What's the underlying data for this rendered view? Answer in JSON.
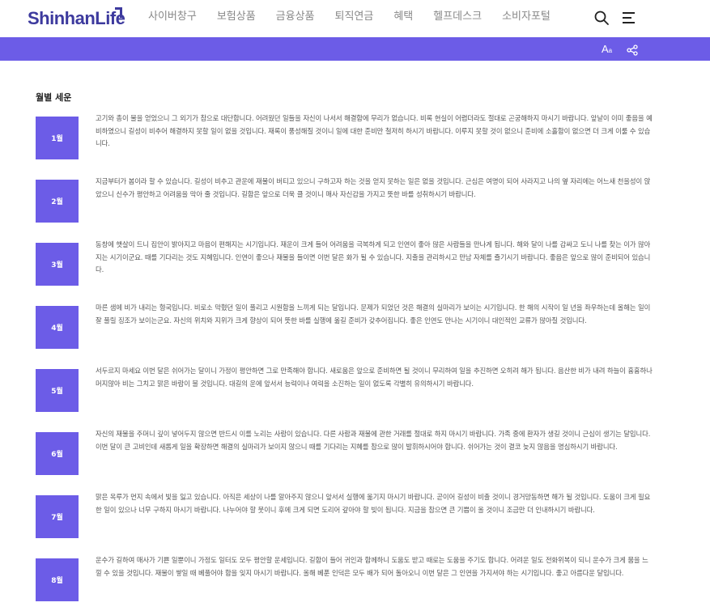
{
  "header": {
    "logo": "ShinhanLife",
    "nav": [
      "사이버창구",
      "보험상품",
      "금융상품",
      "퇴직연금",
      "혜택",
      "헬프데스크",
      "소비자포털"
    ],
    "icons": {
      "search": "search-icon",
      "menu": "menu-icon"
    }
  },
  "toolbar": {
    "font_size_label": "A",
    "font_size_sub": "a",
    "share_icon": "share-icon"
  },
  "colors": {
    "brand": "#3d3a9e",
    "accent": "#6c5ce7"
  },
  "section_title": "월별 세운",
  "months": [
    {
      "label": "1월",
      "text": "고기와 총이 물을 얻었으니 그 외기가 참으로 대단합니다. 어려웠던 일들을 자신이 나서서 해결함에 무리가 없습니다. 비록 현실이 어렵더라도 절대로 곤궁해하지 마시기 바랍니다. 앞날이 이미 좋음을 예비하였으니 길성이 비추어 해결하지 못할 일이 없을 것입니다. 재록이 풍성해질 것이니 일에 대한 준비만 철저히 하시기 바랍니다. 이루지 못할 것이 없으니 준비에 소홀함이 없으면 더 크게 이룰 수 있습니다."
    },
    {
      "label": "2월",
      "text": "지금부터가 봄이라 할 수 있습니다. 길성이 비추고 관운에 재물이 버티고 있으니 구하고자 하는 것을 얻지 못하는 일은 없을 것입니다. 근심은 여명이 되어 사라지고 나의 옆 자리에는 어느새 천을성이 앉았으니 신수가 평안하고 어려움을 막아 줄 것입니다. 길함은 앞으로 더욱 클 것이니 매사 자신감을 가지고 뜻한 바를 성취하시기 바랍니다."
    },
    {
      "label": "3월",
      "text": "동창에 햇살이 드니 집안이 밝아지고 마음이 편해지는 시기입니다. 재운이 크게 들어 어려움을 극복하게 되고 인연이 좋아 많은 사람들을 만나게 됩니다. 해와 달이 나를 감싸고 도니 나를 찾는 이가 많아지는 시기이군요. 때를 기다리는 것도 지혜입니다. 인연이 좋으나 재물을 들이면 이번 달은 화가 될 수 있습니다. 지출을 관리하시고 만남 자체를 즐기시기 바랍니다. 좋음은 앞으로 많이 준비되어 있습니다."
    },
    {
      "label": "4월",
      "text": "마른 샘에 비가 내리는 형국입니다. 비로소 막혔던 일이 풀리고 시원함을 느끼게 되는 달입니다. 문제가 되었던 것은 해결의 실마리가 보이는 시기입니다. 한 해의 시작이 일 년을 좌우하는데 올해는 일이 잘 풀릴 징조가 보이는군요. 자신의 위치와 지위가 크게 향상이 되어 뜻한 바를 실행에 옮길 준비가 갖추어집니다. 좋은 인연도 만나는 시기이니 대인적인 교류가 많아질 것입니다."
    },
    {
      "label": "5월",
      "text": "서두르지 마세요 이번 달은 쉬어가는 달이니 가정이 평안하면 그로 만족해야 합니다. 새로움은 앞으로 준비하면 될 것이니 무리하여 일을 추진하면 오히려 해가 됩니다. 음산한 비가 내려 하늘이 흉흉하나 머지않아 비는 그치고 맑은 바람이 불 것입니다. 대길의 운에 앞서서 능력이나 여력을 소진하는 일이 없도록 각별히 유의하시기 바랍니다."
    },
    {
      "label": "6월",
      "text": "자신의 재물을 주머니 깊이 넣어두지 않으면 반드시 이를 노리는 사람이 있습니다. 다른 사람과 재물에 관한 거래를 절대로 하지 마시기 바랍니다. 가족 중에 환자가 생길 것이니 근심이 생기는 달입니다. 이번 달이 큰 고비인데 새롭게 일을 확장하면 해결의 실마리가 보이지 않으니 때를 기다리는 지혜를 참으로 많이 발휘하시어야 합니다. 쉬어가는 것이 결코 늦지 않음을 명심하시기 바랍니다."
    },
    {
      "label": "7월",
      "text": "맑은 옥루가 먼지 속에서 빛을 잃고 있습니다. 아직은 세상이 나를 알아주지 않으니 앞서서 실행에 옮기지 마시기 바랍니다. 곧이어 길성이 비출 것이니 경거망동하면 해가 될 것입니다. 도움이 크게 필요한 일이 있으나 너무 구하지 마시기 바랍니다. 나누어야 할 뭇이니 후에 크게 되면 도리어 갚아야 할 빚이 됩니다. 지금을 참으면 큰 기쁨이 올 것이니 조금만 더 인내하시기 바랍니다."
    },
    {
      "label": "8월",
      "text": "운수가 길하여 매사가 기쁜 일뿐이니 가정도 일터도 모두 평안할 운세입니다. 길함이 들어 귀인과 함께하니 도움도 받고 때로는 도움을 주기도 합니다. 어려운 일도 전화위복이 되니 운수가 크게 뭄을 느낄 수 있을 것입니다. 재물이 쌓일 때 베풀어야 함을 잊지 마시기 바랍니다. 올해 베푼 인덕은 모두 배가 되어 돌아오니 이번 달은 그 인연을 가지셔야 하는 시기입니다. 좋고 아름다운 달입니다."
    }
  ]
}
